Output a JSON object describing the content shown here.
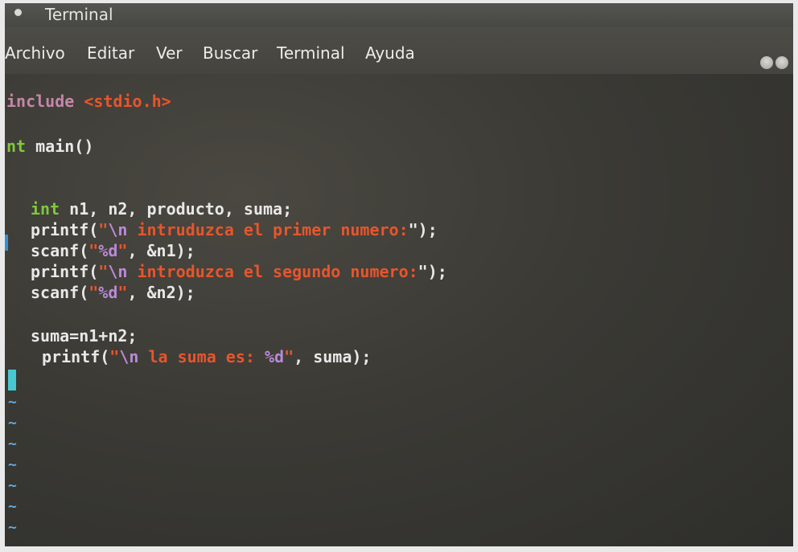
{
  "window": {
    "title": "Terminal"
  },
  "menu": {
    "items": [
      "Archivo",
      "Editar",
      "Ver",
      "Buscar",
      "Terminal",
      "Ayuda"
    ]
  },
  "code": {
    "include_kw": "include",
    "include_header": "<stdio.h>",
    "int_kw": "nt",
    "main_sig": " main()",
    "decl_kw": "int",
    "decl_rest": " n1, n2, producto, suma;",
    "printf1_fn": "printf(",
    "printf1_q": "\"",
    "printf1_esc": "\\n",
    "printf1_str": " intruduzca el primer numero:",
    "printf1_end": "\");",
    "scanf1_fn": "scanf(",
    "scanf1_q": "\"",
    "scanf1_fmt": "%d",
    "scanf1_q2": "\"",
    "scanf1_rest": ", &n1);",
    "printf2_fn": "printf(",
    "printf2_q": "\"",
    "printf2_esc": "\\n",
    "printf2_str": " introduzca el segundo numero:",
    "printf2_end": "\");",
    "scanf2_fn": "scanf(",
    "scanf2_q": "\"",
    "scanf2_fmt": "%d",
    "scanf2_q2": "\"",
    "scanf2_rest": ", &n2);",
    "sum_line": "suma=n1+n2;",
    "printf3_fn": "printf(",
    "printf3_q": "\"",
    "printf3_esc": "\\n",
    "printf3_str": " la suma es: ",
    "printf3_fmt": "%d",
    "printf3_q2": "\"",
    "printf3_rest": ", suma);"
  },
  "empty_line_marker": "~",
  "colors": {
    "keyword": "#7ec83c",
    "preprocessor": "#c586a8",
    "string": "#e8552c",
    "escape": "#b98ad8",
    "cursor": "#49c7d1"
  }
}
